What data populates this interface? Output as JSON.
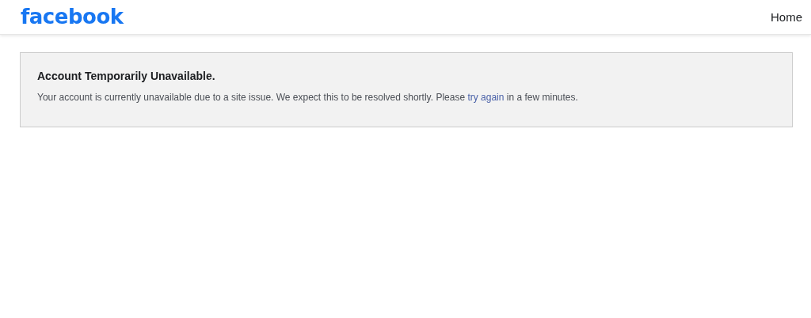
{
  "header": {
    "logo": "facebook",
    "nav": [
      "Home"
    ]
  },
  "notice": {
    "title": "Account Temporarily Unavailable.",
    "message_before": "Your account is currently unavailable due to a site issue. We expect this to be resolved shortly. Please ",
    "link": "try again",
    "message_after": " in a few minutes."
  }
}
